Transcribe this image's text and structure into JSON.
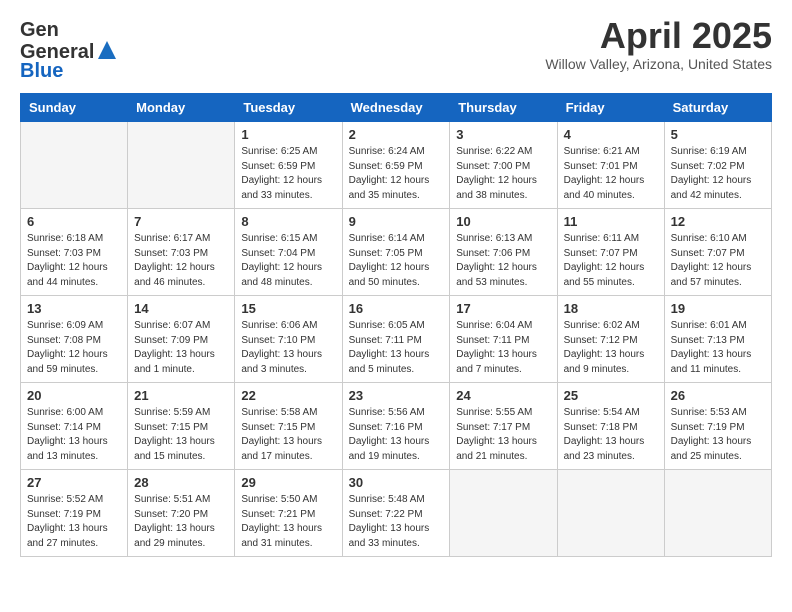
{
  "header": {
    "logo_general": "General",
    "logo_blue": "Blue",
    "month_title": "April 2025",
    "location": "Willow Valley, Arizona, United States"
  },
  "weekdays": [
    "Sunday",
    "Monday",
    "Tuesday",
    "Wednesday",
    "Thursday",
    "Friday",
    "Saturday"
  ],
  "weeks": [
    [
      {
        "day": "",
        "empty": true
      },
      {
        "day": "",
        "empty": true
      },
      {
        "day": "1",
        "sunrise": "6:25 AM",
        "sunset": "6:59 PM",
        "daylight": "12 hours and 33 minutes."
      },
      {
        "day": "2",
        "sunrise": "6:24 AM",
        "sunset": "6:59 PM",
        "daylight": "12 hours and 35 minutes."
      },
      {
        "day": "3",
        "sunrise": "6:22 AM",
        "sunset": "7:00 PM",
        "daylight": "12 hours and 38 minutes."
      },
      {
        "day": "4",
        "sunrise": "6:21 AM",
        "sunset": "7:01 PM",
        "daylight": "12 hours and 40 minutes."
      },
      {
        "day": "5",
        "sunrise": "6:19 AM",
        "sunset": "7:02 PM",
        "daylight": "12 hours and 42 minutes."
      }
    ],
    [
      {
        "day": "6",
        "sunrise": "6:18 AM",
        "sunset": "7:03 PM",
        "daylight": "12 hours and 44 minutes."
      },
      {
        "day": "7",
        "sunrise": "6:17 AM",
        "sunset": "7:03 PM",
        "daylight": "12 hours and 46 minutes."
      },
      {
        "day": "8",
        "sunrise": "6:15 AM",
        "sunset": "7:04 PM",
        "daylight": "12 hours and 48 minutes."
      },
      {
        "day": "9",
        "sunrise": "6:14 AM",
        "sunset": "7:05 PM",
        "daylight": "12 hours and 50 minutes."
      },
      {
        "day": "10",
        "sunrise": "6:13 AM",
        "sunset": "7:06 PM",
        "daylight": "12 hours and 53 minutes."
      },
      {
        "day": "11",
        "sunrise": "6:11 AM",
        "sunset": "7:07 PM",
        "daylight": "12 hours and 55 minutes."
      },
      {
        "day": "12",
        "sunrise": "6:10 AM",
        "sunset": "7:07 PM",
        "daylight": "12 hours and 57 minutes."
      }
    ],
    [
      {
        "day": "13",
        "sunrise": "6:09 AM",
        "sunset": "7:08 PM",
        "daylight": "12 hours and 59 minutes."
      },
      {
        "day": "14",
        "sunrise": "6:07 AM",
        "sunset": "7:09 PM",
        "daylight": "13 hours and 1 minute."
      },
      {
        "day": "15",
        "sunrise": "6:06 AM",
        "sunset": "7:10 PM",
        "daylight": "13 hours and 3 minutes."
      },
      {
        "day": "16",
        "sunrise": "6:05 AM",
        "sunset": "7:11 PM",
        "daylight": "13 hours and 5 minutes."
      },
      {
        "day": "17",
        "sunrise": "6:04 AM",
        "sunset": "7:11 PM",
        "daylight": "13 hours and 7 minutes."
      },
      {
        "day": "18",
        "sunrise": "6:02 AM",
        "sunset": "7:12 PM",
        "daylight": "13 hours and 9 minutes."
      },
      {
        "day": "19",
        "sunrise": "6:01 AM",
        "sunset": "7:13 PM",
        "daylight": "13 hours and 11 minutes."
      }
    ],
    [
      {
        "day": "20",
        "sunrise": "6:00 AM",
        "sunset": "7:14 PM",
        "daylight": "13 hours and 13 minutes."
      },
      {
        "day": "21",
        "sunrise": "5:59 AM",
        "sunset": "7:15 PM",
        "daylight": "13 hours and 15 minutes."
      },
      {
        "day": "22",
        "sunrise": "5:58 AM",
        "sunset": "7:15 PM",
        "daylight": "13 hours and 17 minutes."
      },
      {
        "day": "23",
        "sunrise": "5:56 AM",
        "sunset": "7:16 PM",
        "daylight": "13 hours and 19 minutes."
      },
      {
        "day": "24",
        "sunrise": "5:55 AM",
        "sunset": "7:17 PM",
        "daylight": "13 hours and 21 minutes."
      },
      {
        "day": "25",
        "sunrise": "5:54 AM",
        "sunset": "7:18 PM",
        "daylight": "13 hours and 23 minutes."
      },
      {
        "day": "26",
        "sunrise": "5:53 AM",
        "sunset": "7:19 PM",
        "daylight": "13 hours and 25 minutes."
      }
    ],
    [
      {
        "day": "27",
        "sunrise": "5:52 AM",
        "sunset": "7:19 PM",
        "daylight": "13 hours and 27 minutes."
      },
      {
        "day": "28",
        "sunrise": "5:51 AM",
        "sunset": "7:20 PM",
        "daylight": "13 hours and 29 minutes."
      },
      {
        "day": "29",
        "sunrise": "5:50 AM",
        "sunset": "7:21 PM",
        "daylight": "13 hours and 31 minutes."
      },
      {
        "day": "30",
        "sunrise": "5:48 AM",
        "sunset": "7:22 PM",
        "daylight": "13 hours and 33 minutes."
      },
      {
        "day": "",
        "empty": true
      },
      {
        "day": "",
        "empty": true
      },
      {
        "day": "",
        "empty": true
      }
    ]
  ]
}
